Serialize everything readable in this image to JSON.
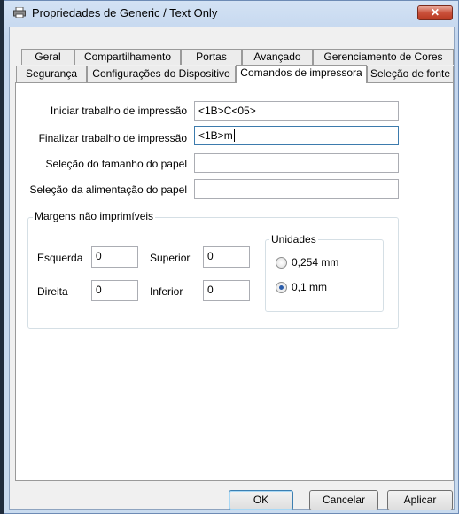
{
  "window": {
    "title": "Propriedades de Generic / Text Only",
    "close": "✕"
  },
  "tabs_row1": [
    "Geral",
    "Compartilhamento",
    "Portas",
    "Avançado",
    "Gerenciamento de Cores"
  ],
  "tabs_row2": [
    "Segurança",
    "Configurações do Dispositivo",
    "Comandos de impressora",
    "Seleção de fonte"
  ],
  "fields": [
    {
      "label": "Iniciar trabalho de impressão",
      "value": "<1B>C<05>"
    },
    {
      "label": "Finalizar trabalho de impressão",
      "value": "<1B>m"
    },
    {
      "label": "Seleção do tamanho do papel",
      "value": ""
    },
    {
      "label": "Seleção da alimentação do papel",
      "value": ""
    }
  ],
  "margins": {
    "title": "Margens não imprimíveis",
    "left_label": "Esquerda",
    "left_value": "0",
    "top_label": "Superior",
    "top_value": "0",
    "right_label": "Direita",
    "right_value": "0",
    "bottom_label": "Inferior",
    "bottom_value": "0"
  },
  "units": {
    "title": "Unidades",
    "options": [
      "0,254 mm",
      "0,1 mm"
    ],
    "selected": "0,1 mm"
  },
  "buttons": {
    "ok": "OK",
    "cancel": "Cancelar",
    "apply": "Aplicar"
  }
}
